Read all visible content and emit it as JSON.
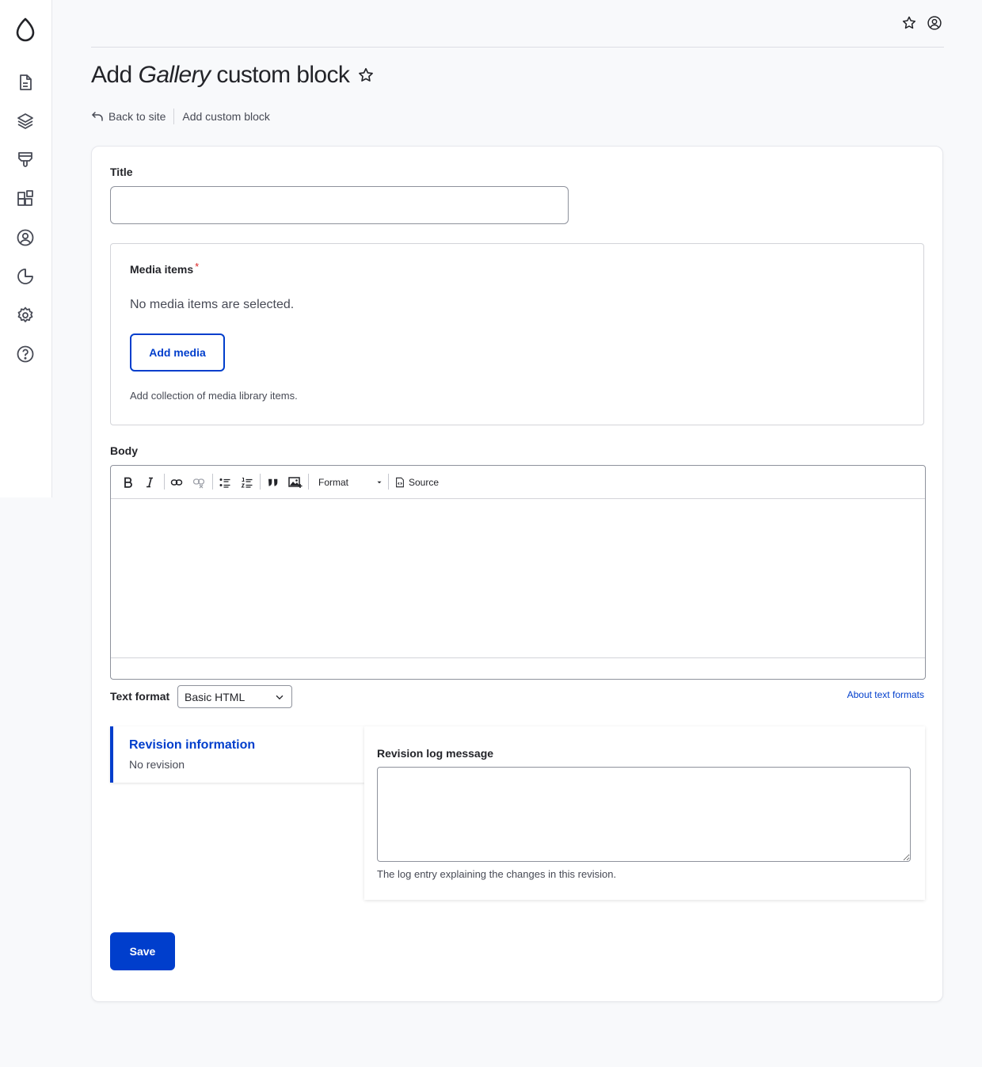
{
  "header": {
    "title_prefix": "Add",
    "title_emphasis": "Gallery",
    "title_suffix": "custom block",
    "icons": [
      "star-icon",
      "user-icon"
    ]
  },
  "breadcrumbs": {
    "back_label": "Back to site",
    "current": "Add custom block"
  },
  "sidebar": {
    "items": [
      {
        "name": "content",
        "icon": "document-icon"
      },
      {
        "name": "structure",
        "icon": "layers-icon"
      },
      {
        "name": "appearance",
        "icon": "brush-icon"
      },
      {
        "name": "extend",
        "icon": "puzzle-icon"
      },
      {
        "name": "people",
        "icon": "person-icon"
      },
      {
        "name": "reports",
        "icon": "pie-chart-icon"
      },
      {
        "name": "configuration",
        "icon": "gear-icon"
      },
      {
        "name": "help",
        "icon": "help-icon"
      }
    ]
  },
  "form": {
    "title_label": "Title",
    "title_value": "",
    "media": {
      "label": "Media items",
      "required_mark": "*",
      "empty_text": "No media items are selected.",
      "button_label": "Add media",
      "description": "Add collection of media library items."
    },
    "body": {
      "label": "Body",
      "toolbar": {
        "format_label": "Format",
        "source_label": "Source"
      },
      "value": ""
    },
    "text_format": {
      "label": "Text format",
      "selected": "Basic HTML",
      "help_link": "About text formats"
    },
    "revision": {
      "tab_title": "Revision information",
      "tab_summary": "No revision",
      "log_label": "Revision log message",
      "log_value": "",
      "log_description": "The log entry explaining the changes in this revision."
    },
    "save_label": "Save"
  },
  "colors": {
    "accent": "#003ecc",
    "required": "#dc2323",
    "background": "#f8f9fb"
  }
}
